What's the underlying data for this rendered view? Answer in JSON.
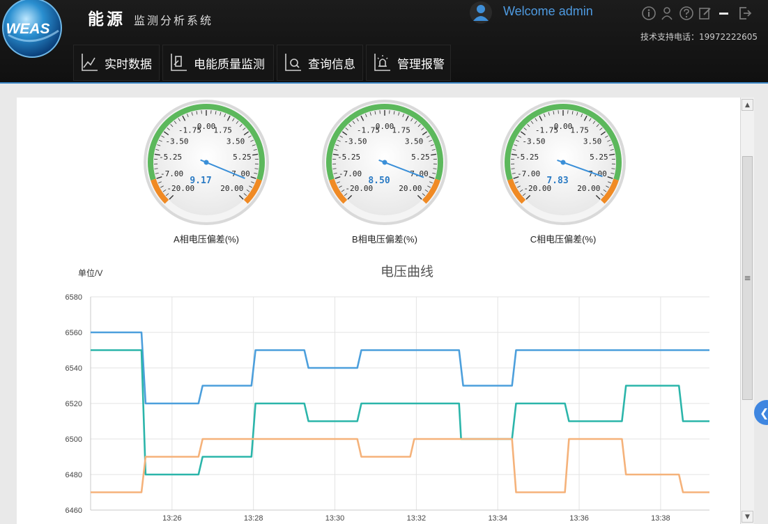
{
  "app": {
    "logo_text": "WEAS",
    "title_main": "能源",
    "title_sub": "监测分析系统",
    "welcome": "Welcome admin",
    "support_phone": "技术支持电话：19972222605",
    "tool_icons": [
      "info-icon",
      "user-icon",
      "help-icon",
      "edit-icon",
      "minimize-icon",
      "exit-icon"
    ]
  },
  "nav": [
    {
      "label": "实时数据",
      "icon": "realtime-chart-icon"
    },
    {
      "label": "电能质量监测",
      "icon": "quality-monitor-icon"
    },
    {
      "label": "查询信息",
      "icon": "query-icon"
    },
    {
      "label": "管理报警",
      "icon": "alarm-icon"
    }
  ],
  "gauges": [
    {
      "label": "A相电压偏差(%)",
      "value_text": "9.17",
      "value": 9.17
    },
    {
      "label": "B相电压偏差(%)",
      "value_text": "8.50",
      "value": 8.5
    },
    {
      "label": "C相电压偏差(%)",
      "value_text": "7.83",
      "value": 7.83
    }
  ],
  "gauge_scale": {
    "ticks": [
      "-20.00",
      "-7.00",
      "-5.25",
      "-3.50",
      "-1.75",
      "0.00",
      "1.75",
      "3.50",
      "5.25",
      "7.00",
      "20.00"
    ],
    "colors": {
      "green": "#5cb85c",
      "orange": "#f08a24",
      "needle": "#3a8fd8",
      "value": "#2b7bc4"
    }
  },
  "chart_data": {
    "type": "line",
    "title": "电压曲线",
    "ylabel": "单位/V",
    "ylim": [
      6460,
      6580
    ],
    "yticks": [
      "6460",
      "6480",
      "6500",
      "6520",
      "6540",
      "6560",
      "6580"
    ],
    "xlim": [
      0,
      15.2
    ],
    "xticks": [
      {
        "label": "13:26",
        "x": 2
      },
      {
        "label": "13:28",
        "x": 4
      },
      {
        "label": "13:30",
        "x": 6
      },
      {
        "label": "13:32",
        "x": 8
      },
      {
        "label": "13:34",
        "x": 10
      },
      {
        "label": "13:36",
        "x": 12
      },
      {
        "label": "13:38",
        "x": 14
      }
    ],
    "series": [
      {
        "color": "#4c9fdc",
        "points": [
          [
            0,
            6560
          ],
          [
            1.25,
            6560
          ],
          [
            1.35,
            6520
          ],
          [
            2.65,
            6520
          ],
          [
            2.75,
            6530
          ],
          [
            3.95,
            6530
          ],
          [
            4.05,
            6550
          ],
          [
            5.25,
            6550
          ],
          [
            5.35,
            6540
          ],
          [
            6.55,
            6540
          ],
          [
            6.65,
            6550
          ],
          [
            9.05,
            6550
          ],
          [
            9.15,
            6530
          ],
          [
            10.35,
            6530
          ],
          [
            10.45,
            6550
          ],
          [
            15.2,
            6550
          ]
        ]
      },
      {
        "color": "#2bb5aa",
        "points": [
          [
            0,
            6550
          ],
          [
            1.25,
            6550
          ],
          [
            1.35,
            6480
          ],
          [
            2.65,
            6480
          ],
          [
            2.75,
            6490
          ],
          [
            3.95,
            6490
          ],
          [
            4.05,
            6520
          ],
          [
            5.25,
            6520
          ],
          [
            5.35,
            6510
          ],
          [
            6.55,
            6510
          ],
          [
            6.65,
            6520
          ],
          [
            9.05,
            6520
          ],
          [
            9.1,
            6500
          ],
          [
            10.35,
            6500
          ],
          [
            10.45,
            6520
          ],
          [
            11.65,
            6520
          ],
          [
            11.75,
            6510
          ],
          [
            13.05,
            6510
          ],
          [
            13.15,
            6530
          ],
          [
            14.45,
            6530
          ],
          [
            14.55,
            6510
          ],
          [
            15.2,
            6510
          ]
        ]
      },
      {
        "color": "#f5b27a",
        "points": [
          [
            0,
            6470
          ],
          [
            1.25,
            6470
          ],
          [
            1.35,
            6490
          ],
          [
            2.65,
            6490
          ],
          [
            2.75,
            6500
          ],
          [
            6.55,
            6500
          ],
          [
            6.65,
            6490
          ],
          [
            7.85,
            6490
          ],
          [
            7.95,
            6500
          ],
          [
            10.35,
            6500
          ],
          [
            10.45,
            6470
          ],
          [
            11.65,
            6470
          ],
          [
            11.75,
            6500
          ],
          [
            13.05,
            6500
          ],
          [
            13.15,
            6480
          ],
          [
            14.45,
            6480
          ],
          [
            14.55,
            6470
          ],
          [
            15.2,
            6470
          ]
        ]
      }
    ]
  }
}
